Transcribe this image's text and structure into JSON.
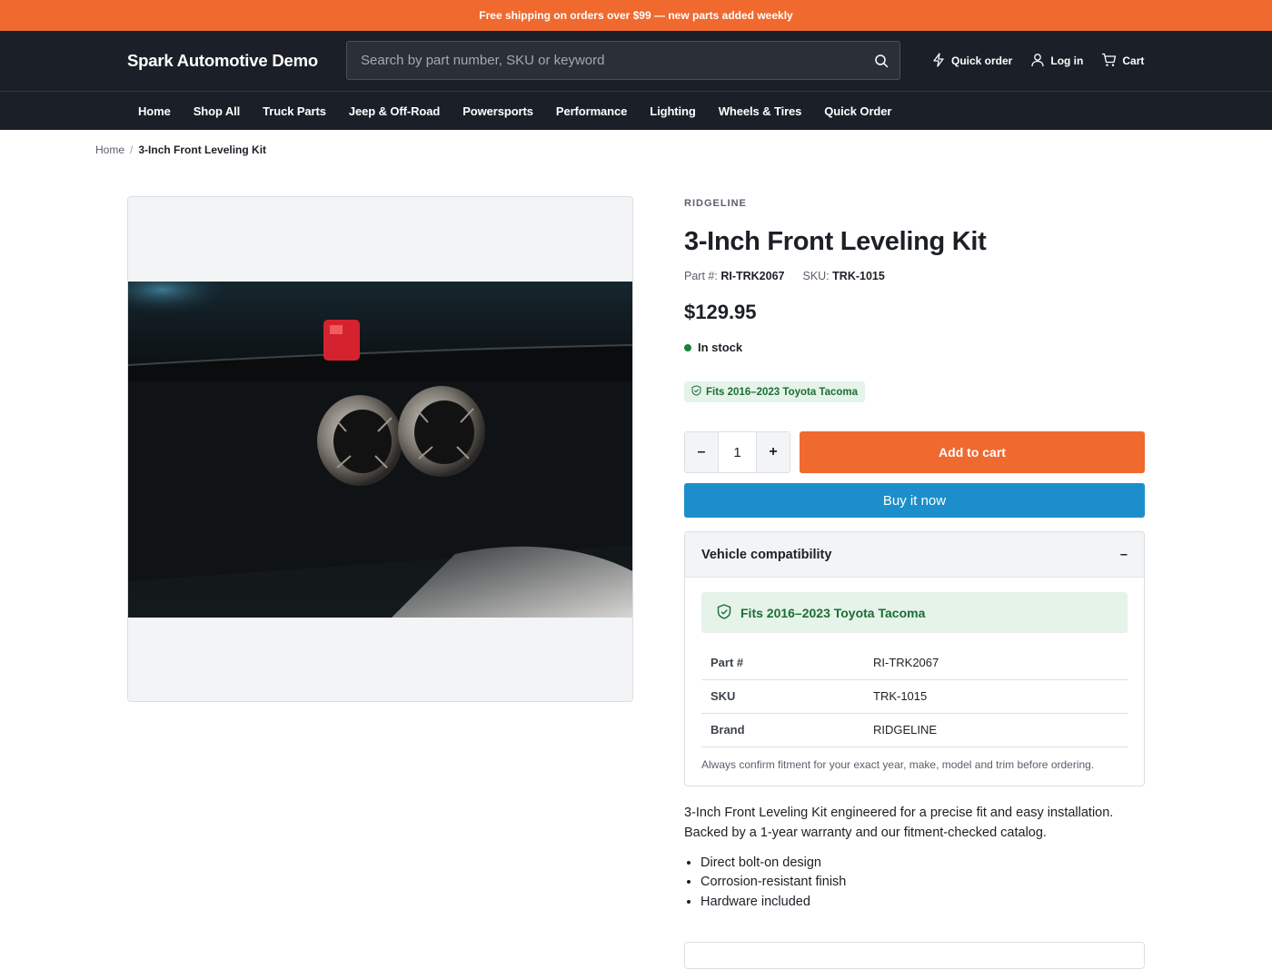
{
  "announcement": "Free shipping on orders over $99 — new parts added weekly",
  "header": {
    "logo": "Spark Automotive Demo",
    "search_placeholder": "Search by part number, SKU or keyword",
    "actions": {
      "quick_order": "Quick order",
      "login": "Log in",
      "cart": "Cart"
    }
  },
  "nav": [
    "Home",
    "Shop All",
    "Truck Parts",
    "Jeep & Off-Road",
    "Powersports",
    "Performance",
    "Lighting",
    "Wheels & Tires",
    "Quick Order"
  ],
  "breadcrumb": {
    "home": "Home",
    "separator": "/",
    "current": "3-Inch Front Leveling Kit"
  },
  "product": {
    "brand": "RIDGELINE",
    "title": "3-Inch Front Leveling Kit",
    "part_label": "Part #:",
    "part_value": "RI-TRK2067",
    "sku_label": "SKU:",
    "sku_value": "TRK-1015",
    "price": "$129.95",
    "stock": "In stock",
    "fit_badge": "Fits 2016–2023 Toyota Tacoma",
    "quantity": "1",
    "qty_minus": "–",
    "qty_plus": "+",
    "add_to_cart": "Add to cart",
    "buy_now": "Buy it now"
  },
  "compat": {
    "heading": "Vehicle compatibility",
    "toggle": "–",
    "fit": "Fits 2016–2023 Toyota Tacoma",
    "rows": [
      {
        "k": "Part #",
        "v": "RI-TRK2067"
      },
      {
        "k": "SKU",
        "v": "TRK-1015"
      },
      {
        "k": "Brand",
        "v": "RIDGELINE"
      }
    ],
    "note": "Always confirm fitment for your exact year, make, model and trim before ordering."
  },
  "description": "3-Inch Front Leveling Kit engineered for a precise fit and easy installation. Backed by a 1-year warranty and our fitment-checked catalog.",
  "bullets": [
    "Direct bolt-on design",
    "Corrosion-resistant finish",
    "Hardware included"
  ],
  "colors": {
    "accent": "#f0692e",
    "header": "#1b1f27",
    "buy_now": "#1c8fcb",
    "in_stock": "#16803c",
    "fit_bg": "#e6f3e9",
    "fit_text": "#1b6e35"
  },
  "icons": {
    "search": "search-icon",
    "quick_order": "bolt-icon",
    "login": "user-icon",
    "cart": "cart-icon",
    "fit": "shield-check-icon"
  }
}
